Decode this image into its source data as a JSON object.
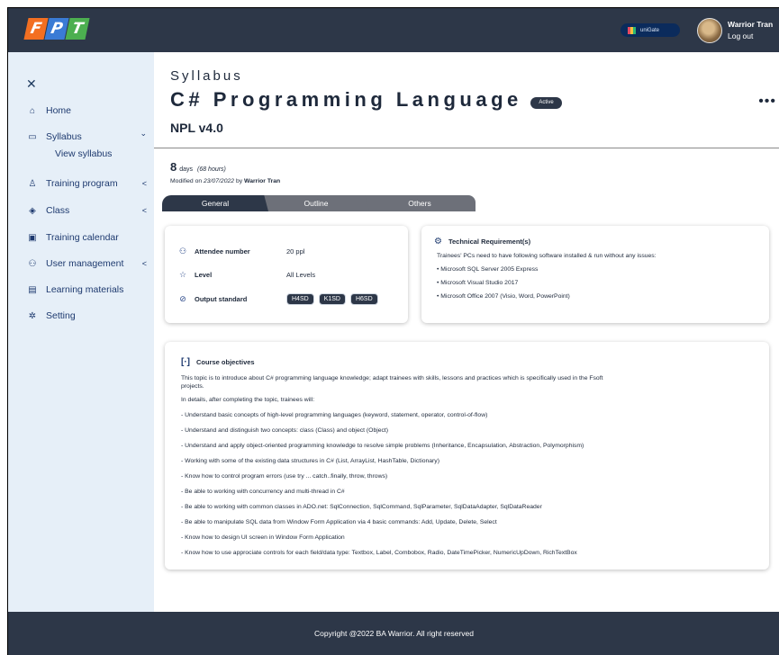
{
  "header": {
    "logo_letters": [
      "F",
      "P",
      "T"
    ],
    "unigate_label": "uniGate",
    "user_name": "Warrior Tran",
    "logout_label": "Log out"
  },
  "sidebar": {
    "close_glyph": "✕",
    "items": [
      {
        "label": "Home",
        "icon": "home-icon",
        "chevron": ""
      },
      {
        "label": "Syllabus",
        "icon": "book-icon",
        "chevron": "⌄"
      },
      {
        "label": "Training program",
        "icon": "microscope-icon",
        "chevron": "<"
      },
      {
        "label": "Class",
        "icon": "graduation-cap-icon",
        "chevron": "<"
      },
      {
        "label": "Training calendar",
        "icon": "calendar-icon",
        "chevron": ""
      },
      {
        "label": "User management",
        "icon": "users-icon",
        "chevron": "<"
      },
      {
        "label": "Learning materials",
        "icon": "folder-icon",
        "chevron": ""
      },
      {
        "label": "Setting",
        "icon": "gear-icon",
        "chevron": ""
      }
    ],
    "sub_item": "View syllabus"
  },
  "page": {
    "breadcrumb": "Syllabus",
    "title": "C# Programming Language",
    "status_badge": "Active",
    "more_glyph": "•••",
    "version": "NPL v4.0",
    "days_count": "8",
    "days_unit": "days",
    "hours": "(68 hours)",
    "modified_prefix": "Modified on",
    "modified_date": "23/07/2022",
    "modified_by_word": "by",
    "modified_by": "Warrior Tran"
  },
  "tabs": [
    "General",
    "Outline",
    "Others"
  ],
  "info_card": {
    "attendee_label": "Attendee number",
    "attendee_value": "20 ppl",
    "level_label": "Level",
    "level_value": "All Levels",
    "output_label": "Output standard",
    "output_chips": [
      "H4SD",
      "K1SD",
      "H6SD"
    ]
  },
  "tech_card": {
    "title": "Technical Requirement(s)",
    "intro": "Trainees' PCs need to have following software installed & run without any issues:",
    "items": [
      "• Microsoft SQL Server 2005 Express",
      "• Microsoft Visual Studio 2017",
      "• Microsoft Office 2007 (Visio, Word, PowerPoint)"
    ]
  },
  "objectives": {
    "title": "Course objectives",
    "lines": [
      "This topic is to introduce about C# programming language knowledge; adapt trainees with skills, lessons and practices which is specifically used in the Fsoft",
      "projects.",
      "In details, after completing the topic, trainees will:",
      "- Understand basic concepts of high-level programming languages (keyword, statement, operator, control-of-flow)",
      "- Understand and distinguish two concepts: class (Class) and object (Object)",
      "- Understand and apply object-oriented programming knowledge to resolve simple problems (Inheritance, Encapsulation, Abstraction, Polymorphism)",
      "- Working with some of the existing data structures in C# (List, ArrayList, HashTable, Dictionary)",
      "- Know how to control program errors (use try ... catch..finally, throw, throws)",
      "- Be able to working with concurrency and multi-thread in C#",
      "- Be able to working with common classes in ADO.net: SqlConnection, SqlCommand, SqlParameter, SqlDataAdapter, SqlDataReader",
      "- Be able to manipulate SQL data from Window Form Application via 4 basic commands: Add, Update, Delete, Select",
      "- Know how to design UI screen in Window Form Application",
      "- Know how to use approciate controls for each field/data type: Textbox, Label, Combobox, Radio, DateTimePicker,  NumericUpDown, RichTextBox"
    ]
  },
  "footer": {
    "copyright": "Copyright @2022 BA Warrior. All right reserved"
  },
  "colors": {
    "header_bg": "#2d3748",
    "sidebar_bg": "#e6eff8",
    "nav_text": "#1e3a6f",
    "tab_active": "#2d3748",
    "tab_inactive": "#6d7079"
  }
}
